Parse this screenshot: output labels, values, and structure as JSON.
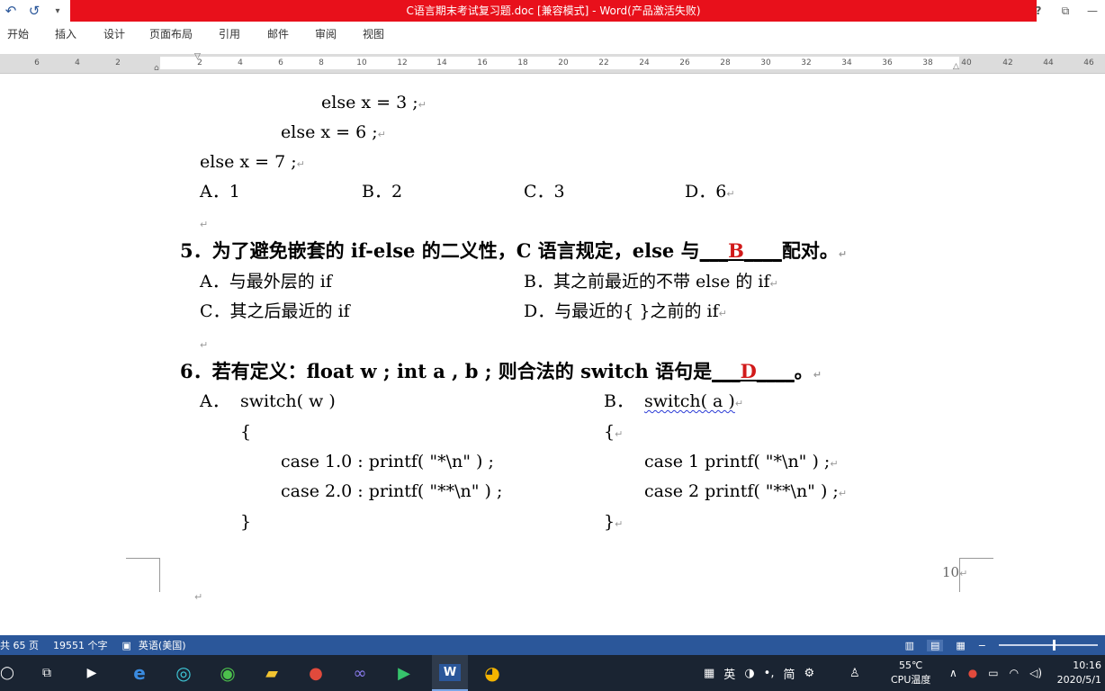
{
  "window": {
    "title": "C语言期末考试复习题.doc [兼容模式] -  Word(产品激活失败)",
    "help_label": "?",
    "restore_label": "⧉",
    "min_label": "—"
  },
  "qat": {
    "undo": "↶",
    "redo": "↺",
    "customize": "▾"
  },
  "ribbon": {
    "tabs": [
      "开始",
      "插入",
      "设计",
      "页面布局",
      "引用",
      "邮件",
      "审阅",
      "视图"
    ]
  },
  "ruler": {
    "labels": [
      "6",
      "4",
      "2",
      "2",
      "4",
      "6",
      "8",
      "10",
      "12",
      "14",
      "16",
      "18",
      "20",
      "22",
      "24",
      "26",
      "28",
      "30",
      "32",
      "34",
      "36",
      "38",
      "40",
      "42",
      "44",
      "46"
    ]
  },
  "document": {
    "top_lines": {
      "else3": "else x = 3 ;",
      "else6": "else x = 6 ;",
      "else7": "else x = 7 ;"
    },
    "q4_options": {
      "a": "A．1",
      "b": "B．2",
      "c": "C．3",
      "d": "D．6"
    },
    "q5": {
      "stem": "5．为了避免嵌套的 if-else 的二义性，C 语言规定，else 与",
      "blank_before": "___",
      "answer": "B",
      "blank_after": "____",
      "tail": "配对。",
      "options": {
        "a": "A．与最外层的 if",
        "b": "B．其之前最近的不带 else 的 if",
        "c": "C．其之后最近的 if",
        "d": "D．与最近的{ }之前的 if"
      }
    },
    "q6": {
      "stem": "6．若有定义：float w ; int a , b ;  则合法的 switch 语句是",
      "blank_before": "___",
      "answer": "D",
      "blank_after": "____",
      "tail": "。",
      "option_a": {
        "label": "A．",
        "head": "switch( w )",
        "open": "{",
        "case1": "case 1.0 : printf( \"*\\n\" ) ;",
        "case2": "case 2.0 : printf( \"**\\n\" ) ;",
        "close": "}"
      },
      "option_b": {
        "label": "B．",
        "head": "switch( a )",
        "open": "{",
        "case1": "case 1 printf( \"*\\n\" ) ;",
        "case2": "case 2 printf( \"**\\n\" ) ;",
        "close": "}"
      }
    },
    "page_number": "10",
    "para_mark": "↵"
  },
  "statusbar": {
    "pages": "共 65 页",
    "words": "19551 个字",
    "language": "英语(美国)"
  },
  "taskbar": {
    "ime": [
      "英",
      "简"
    ],
    "temp_value": "55℃",
    "temp_label": "CPU温度",
    "time": "10:16",
    "date": "2020/5/1"
  },
  "colors": {
    "title_bar": "#e8101b",
    "status_bar": "#2b579a",
    "answer_red": "#d11a1a",
    "taskbar": "#1a2432"
  },
  "icons": [
    "undo-icon",
    "redo-icon",
    "help-icon",
    "restore-icon",
    "read-mode-icon",
    "print-layout-icon",
    "web-layout-icon",
    "start-icon",
    "task-view-icon",
    "edge-icon",
    "word-icon"
  ]
}
